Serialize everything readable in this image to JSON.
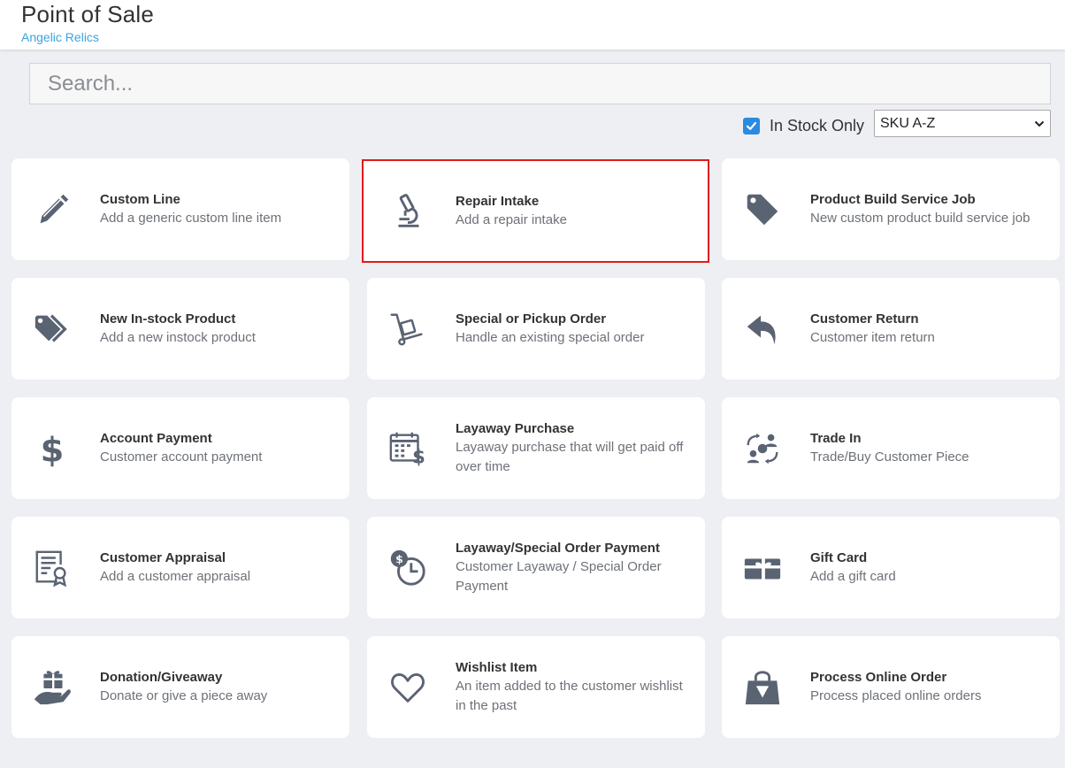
{
  "header": {
    "title": "Point of Sale",
    "subtitle": "Angelic Relics"
  },
  "search": {
    "placeholder": "Search..."
  },
  "filters": {
    "in_stock_label": "In Stock Only",
    "in_stock_checked": true,
    "sort_value": "SKU A-Z"
  },
  "colors": {
    "icon": "#5a6372",
    "selected_outline": "#e01b1b",
    "checkbox": "#2a8ae2",
    "subtitle": "#3ba4e0"
  },
  "cards": [
    {
      "title": "Custom Line",
      "desc": "Add a generic custom line item",
      "icon": "pencil-icon"
    },
    {
      "title": "Repair Intake",
      "desc": "Add a repair intake",
      "icon": "microscope-icon",
      "selected": true
    },
    {
      "title": "Product Build Service Job",
      "desc": "New custom product build service job",
      "icon": "tag-icon"
    },
    {
      "title": "New In-stock Product",
      "desc": "Add a new instock product",
      "icon": "tags-icon"
    },
    {
      "title": "Special or Pickup Order",
      "desc": "Handle an existing special order",
      "icon": "hand-truck-icon"
    },
    {
      "title": "Customer Return",
      "desc": "Customer item return",
      "icon": "reply-icon"
    },
    {
      "title": "Account Payment",
      "desc": "Customer account payment",
      "icon": "dollar-icon"
    },
    {
      "title": "Layaway Purchase",
      "desc": "Layaway purchase that will get paid off over time",
      "icon": "calendar-dollar-icon"
    },
    {
      "title": "Trade In",
      "desc": "Trade/Buy Customer Piece",
      "icon": "trade-exchange-icon"
    },
    {
      "title": "Customer Appraisal",
      "desc": "Add a customer appraisal",
      "icon": "certificate-icon"
    },
    {
      "title": "Layaway/Special Order Payment",
      "desc": "Customer Layaway / Special Order Payment",
      "icon": "coin-clock-icon"
    },
    {
      "title": "Gift Card",
      "desc": "Add a gift card",
      "icon": "gift-card-icon"
    },
    {
      "title": "Donation/Giveaway",
      "desc": "Donate or give a piece away",
      "icon": "hand-gift-icon"
    },
    {
      "title": "Wishlist Item",
      "desc": "An item added to the customer wishlist in the past",
      "icon": "heart-icon"
    },
    {
      "title": "Process Online Order",
      "desc": "Process placed online orders",
      "icon": "shopping-bag-icon"
    }
  ]
}
